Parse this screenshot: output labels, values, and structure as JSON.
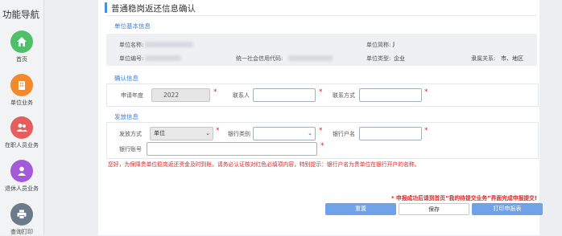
{
  "sidebar": {
    "title": "功能导航",
    "items": [
      {
        "label": "首页",
        "icon": "home-icon",
        "color": "#4fbf6a"
      },
      {
        "label": "单位业务",
        "icon": "building-icon",
        "color": "#f08a2c"
      },
      {
        "label": "在职人员业务",
        "icon": "people-icon",
        "color": "#e55d5d"
      },
      {
        "label": "退休人员业务",
        "icon": "person-icon",
        "color": "#a35ad9"
      },
      {
        "label": "查询打印",
        "icon": "printer-icon",
        "color": "#6c7a8c"
      }
    ]
  },
  "page": {
    "title": "普通稳岗返还信息确认"
  },
  "basic_info": {
    "section_title": "单位基本信息",
    "unit_name_label": "单位名称:",
    "unit_abbr_label": "单位简称:",
    "unit_abbr_value": "J",
    "unit_code_label": "单位编号:",
    "credit_code_label": "统一社会信用代码:",
    "unit_type_label": "单位类型:",
    "unit_type_value": "企业",
    "affiliation_label": "隶属关系:",
    "affiliation_value": "市、地区"
  },
  "confirm_info": {
    "section_title": "确认信息",
    "year_label": "申请年度",
    "year_value": "2022",
    "contact_label": "联系人",
    "contact_value": "",
    "phone_label": "联系方式",
    "phone_value": ""
  },
  "payment_info": {
    "section_title": "发放信息",
    "method_label": "发放方式",
    "method_value": "单位",
    "bank_type_label": "银行类别",
    "bank_type_value": "",
    "account_name_label": "银行户名",
    "account_name_value": "",
    "account_no_label": "银行账号",
    "account_no_value": ""
  },
  "notice": "您好，为保障贵单位稳岗返还资金及时到账，请务必认证核对红色必填项内容，特别提示：银行户名为贵单位在银行开户的名称。",
  "tip": "* 申报成功后请到首页“我的待提交业务”界面完成申报提交!",
  "actions": {
    "reset": "重置",
    "save": "保存",
    "print": "打印申报表"
  },
  "colors": {
    "accent": "#3a7fd5",
    "required": "#e02424",
    "button": "#6fa2e8"
  }
}
